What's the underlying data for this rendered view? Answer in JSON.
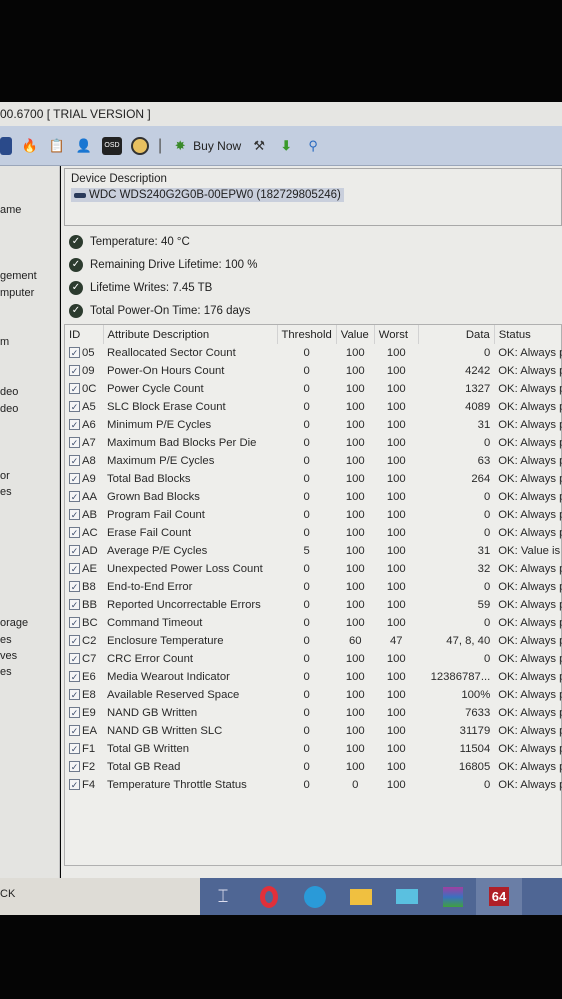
{
  "title": "00.6700  [ TRIAL VERSION ]",
  "toolbar": {
    "icons": [
      "drive-icon",
      "flame-icon",
      "clipboard-icon",
      "user-icon",
      "osd-icon",
      "gauge-icon",
      "buy-now-icon",
      "tool-icon",
      "download-icon",
      "search-icon"
    ],
    "buy_now": "Buy Now",
    "osd": "OSD"
  },
  "sidebar": {
    "items": [
      "ame",
      "gement",
      "mputer",
      "m",
      "deo",
      "deo",
      "or",
      "es",
      "orage",
      "es",
      "ves",
      "es"
    ],
    "bottom": "CK"
  },
  "device": {
    "label": "Device Description",
    "name": "WDC WDS240G2G0B-00EPW0 (182729805246)"
  },
  "status": [
    "Temperature: 40 °C",
    "Remaining Drive Lifetime: 100 %",
    "Lifetime Writes: 7.45 TB",
    "Total Power-On Time: 176 days"
  ],
  "table": {
    "headers": [
      "ID",
      "Attribute Description",
      "Threshold",
      "Value",
      "Worst",
      "Data",
      "Status"
    ],
    "rows": [
      [
        "05",
        "Reallocated Sector Count",
        "0",
        "100",
        "100",
        "0",
        "OK: Always pa"
      ],
      [
        "09",
        "Power-On Hours Count",
        "0",
        "100",
        "100",
        "4242",
        "OK: Always pa"
      ],
      [
        "0C",
        "Power Cycle Count",
        "0",
        "100",
        "100",
        "1327",
        "OK: Always pa"
      ],
      [
        "A5",
        "SLC Block Erase Count",
        "0",
        "100",
        "100",
        "4089",
        "OK: Always pa"
      ],
      [
        "A6",
        "Minimum P/E Cycles",
        "0",
        "100",
        "100",
        "31",
        "OK: Always pa"
      ],
      [
        "A7",
        "Maximum Bad Blocks Per Die",
        "0",
        "100",
        "100",
        "0",
        "OK: Always pa"
      ],
      [
        "A8",
        "Maximum P/E Cycles",
        "0",
        "100",
        "100",
        "63",
        "OK: Always pa"
      ],
      [
        "A9",
        "Total Bad Blocks",
        "0",
        "100",
        "100",
        "264",
        "OK: Always pa"
      ],
      [
        "AA",
        "Grown Bad Blocks",
        "0",
        "100",
        "100",
        "0",
        "OK: Always pas"
      ],
      [
        "AB",
        "Program Fail Count",
        "0",
        "100",
        "100",
        "0",
        "OK: Always pas"
      ],
      [
        "AC",
        "Erase Fail Count",
        "0",
        "100",
        "100",
        "0",
        "OK: Always pas"
      ],
      [
        "AD",
        "Average P/E Cycles",
        "5",
        "100",
        "100",
        "31",
        "OK: Value is no"
      ],
      [
        "AE",
        "Unexpected Power Loss Count",
        "0",
        "100",
        "100",
        "32",
        "OK: Always pas"
      ],
      [
        "B8",
        "End-to-End Error",
        "0",
        "100",
        "100",
        "0",
        "OK: Always pas"
      ],
      [
        "BB",
        "Reported Uncorrectable Errors",
        "0",
        "100",
        "100",
        "59",
        "OK: Always pas"
      ],
      [
        "BC",
        "Command Timeout",
        "0",
        "100",
        "100",
        "0",
        "OK: Always pas"
      ],
      [
        "C2",
        "Enclosure Temperature",
        "0",
        "60",
        "47",
        "47, 8, 40",
        "OK: Always pas"
      ],
      [
        "C7",
        "CRC Error Count",
        "0",
        "100",
        "100",
        "0",
        "OK: Always pas"
      ],
      [
        "E6",
        "Media Wearout Indicator",
        "0",
        "100",
        "100",
        "12386787...",
        "OK: Always pas"
      ],
      [
        "E8",
        "Available Reserved Space",
        "0",
        "100",
        "100",
        "100%",
        "OK: Always pas"
      ],
      [
        "E9",
        "NAND GB Written",
        "0",
        "100",
        "100",
        "7633",
        "OK: Always pas"
      ],
      [
        "EA",
        "NAND GB Written SLC",
        "0",
        "100",
        "100",
        "31179",
        "OK: Always pas"
      ],
      [
        "F1",
        "Total GB Written",
        "0",
        "100",
        "100",
        "11504",
        "OK: Always pas"
      ],
      [
        "F2",
        "Total GB Read",
        "0",
        "100",
        "100",
        "16805",
        "OK: Always pas"
      ],
      [
        "F4",
        "Temperature Throttle Status",
        "0",
        "0",
        "100",
        "0",
        "OK: Always pas"
      ]
    ]
  },
  "taskbar": {
    "icons": [
      "task-view-icon",
      "opera-icon",
      "edge-icon",
      "file-explorer-icon",
      "mail-icon",
      "winrar-icon",
      "aida64-icon"
    ],
    "aida_label": "64"
  }
}
